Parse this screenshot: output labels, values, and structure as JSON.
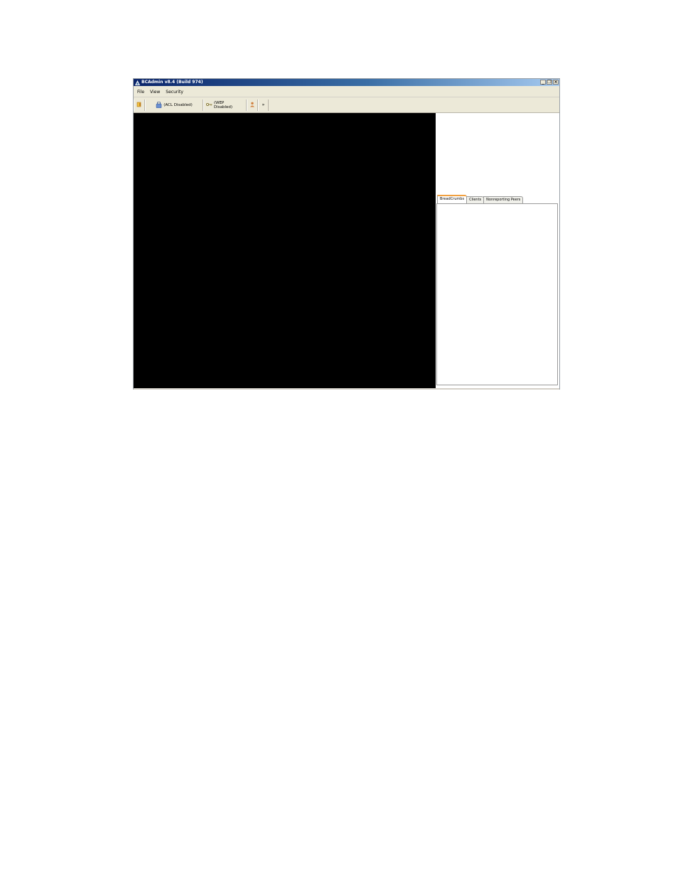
{
  "window": {
    "title": "BCAdmin v8.4 (Build 974)"
  },
  "menu": {
    "items": [
      "File",
      "View",
      "Security"
    ]
  },
  "toolbar": {
    "acl_label": "(ACL Disabled)",
    "wep_label": "(WEP Disabled)"
  },
  "tabs": {
    "items": [
      "BreadCrumbs",
      "Clients",
      "Nonreporting Peers"
    ],
    "active": "BreadCrumbs"
  },
  "colors": {
    "titlebar_start": "#0a246a",
    "titlebar_end": "#a6caf0",
    "canvas": "#000000",
    "active_tab_accent": "#f0a040"
  }
}
